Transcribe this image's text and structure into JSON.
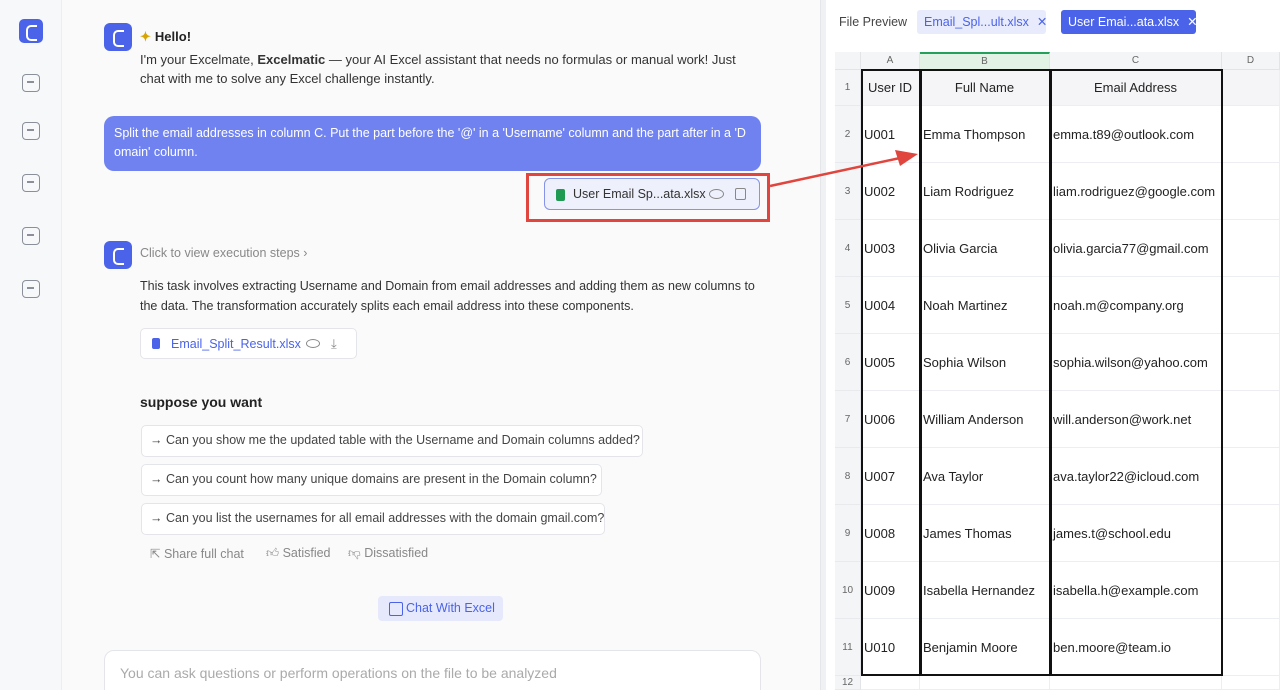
{
  "chat": {
    "hello": "Hello!",
    "intro_pre": "I'm your Excelmate, ",
    "intro_brand": "Excelmatic",
    "intro_post": " — your AI Excel assistant that needs no formulas or manual work! Just chat with me to solve any Excel challenge instantly.",
    "user_message": "Split the email addresses in column C. Put the part before the '@' in a 'Username' column and the part after in a 'D omain' column.",
    "attached_file": "User Email Sp...ata.xlsx",
    "steps_link": "Click to view execution steps",
    "description": "This task involves extracting Username and Domain from email addresses and adding them as new columns to the data. The transformation accurately splits each email address into these components.",
    "result_file": "Email_Split_Result.xlsx",
    "suppose_title": "suppose you want",
    "suggestions": [
      "→ Can you show me the updated table with the Username and Domain columns added?",
      "→ Can you count how many unique domains are present in the Domain column?",
      "→ Can you list the usernames for all email addresses with the domain gmail.com?"
    ],
    "share": "Share full chat",
    "satisfied": "Satisfied",
    "dissatisfied": "Dissatisfied",
    "chat_with_excel": "Chat With Excel",
    "input_placeholder": "You can ask questions or perform operations on the file to be analyzed"
  },
  "preview": {
    "title": "File Preview",
    "tabs": [
      "Email_Spl...ult.xlsx",
      "User Emai...ata.xlsx"
    ],
    "col_letters": [
      "A",
      "B",
      "C",
      "D"
    ],
    "row_numbers": [
      "1",
      "2",
      "3",
      "4",
      "5",
      "6",
      "7",
      "8",
      "9",
      "10",
      "11",
      "12"
    ],
    "headers": [
      "User ID",
      "Full Name",
      "Email Address"
    ],
    "rows": [
      [
        "U001",
        "Emma Thompson",
        "emma.t89@outlook.com"
      ],
      [
        "U002",
        "Liam Rodriguez",
        "liam.rodriguez@google.com"
      ],
      [
        "U003",
        "Olivia Garcia",
        "olivia.garcia77@gmail.com"
      ],
      [
        "U004",
        "Noah Martinez",
        "noah.m@company.org"
      ],
      [
        "U005",
        "Sophia Wilson",
        "sophia.wilson@yahoo.com"
      ],
      [
        "U006",
        "William Anderson",
        "will.anderson@work.net"
      ],
      [
        "U007",
        "Ava Taylor",
        "ava.taylor22@icloud.com"
      ],
      [
        "U008",
        "James Thomas",
        "james.t@school.edu"
      ],
      [
        "U009",
        "Isabella Hernandez",
        "isabella.h@example.com"
      ],
      [
        "U010",
        "Benjamin Moore",
        "ben.moore@team.io"
      ]
    ]
  },
  "colors": {
    "accent": "#4a63e8",
    "bubble": "#6f82f0",
    "highlight_red": "#e0453e",
    "excel_green": "#1e9a52"
  },
  "icons": [
    "app-logo-icon",
    "sidebar-toggle-icon",
    "new-chat-icon",
    "image-icon",
    "file-icon",
    "apps-icon",
    "xlsx-file-icon",
    "eye-icon",
    "copy-icon",
    "download-icon",
    "share-icon",
    "thumbs-up-icon",
    "thumbs-down-icon",
    "close-icon"
  ]
}
